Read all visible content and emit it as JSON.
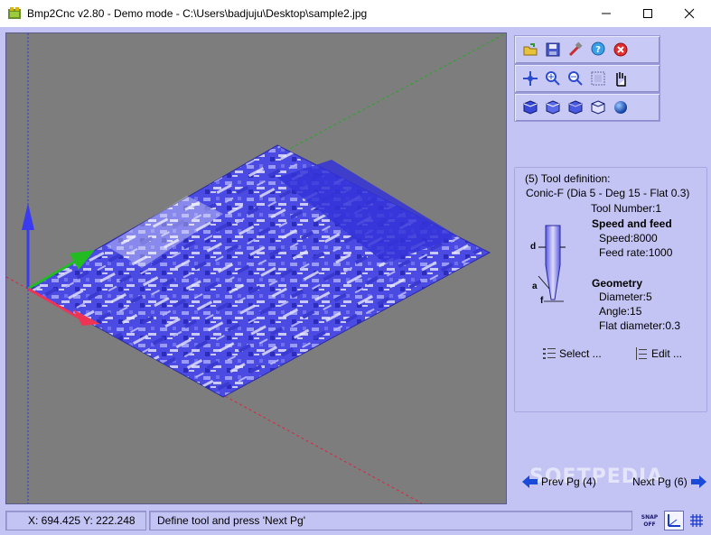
{
  "window": {
    "title": "Bmp2Cnc v2.80 - Demo mode - C:\\Users\\badjuju\\Desktop\\sample2.jpg"
  },
  "toolbar": {
    "row1": [
      "open-icon",
      "save-icon",
      "tools-icon",
      "help-icon",
      "close-circle-icon"
    ],
    "row2": [
      "move-icon",
      "zoom-in-icon",
      "zoom-out-icon",
      "zoom-fit-icon",
      "pan-hand-icon"
    ],
    "row3": [
      "view-iso-1-icon",
      "view-iso-2-icon",
      "view-iso-3-icon",
      "view-wire-icon",
      "sphere-render-icon"
    ]
  },
  "tool_panel": {
    "header": "(5) Tool definition:",
    "tool_name": "Conic-F (Dia 5 - Deg 15 - Flat 0.3)",
    "tool_number": "Tool Number:1",
    "speed_heading": "Speed and feed",
    "speed": "Speed:8000",
    "feed_rate": "Feed rate:1000",
    "geometry_heading": "Geometry",
    "diameter": "Diameter:5",
    "angle": "Angle:15",
    "flat_diameter": "Flat diameter:0.3",
    "label_d": "d",
    "label_a": "a",
    "label_f": "f",
    "select_label": "Select ...",
    "edit_label": "Edit ..."
  },
  "navigation": {
    "prev_label": "Prev Pg (4)",
    "next_label": "Next Pg (6)"
  },
  "watermark": "SOFTPEDIA",
  "status": {
    "coords": "X: 694.425 Y: 222.248",
    "message": "Define tool and press 'Next Pg'",
    "snap_label_1": "SNAP",
    "snap_label_2": "OFF"
  },
  "colors": {
    "client_bg": "#c4c4f4",
    "viewport_bg": "#7d7d7d",
    "surface": "#4a4ae6",
    "axis_blue": "#3333dd",
    "axis_green": "#22aa22",
    "axis_red": "#dd2244"
  }
}
